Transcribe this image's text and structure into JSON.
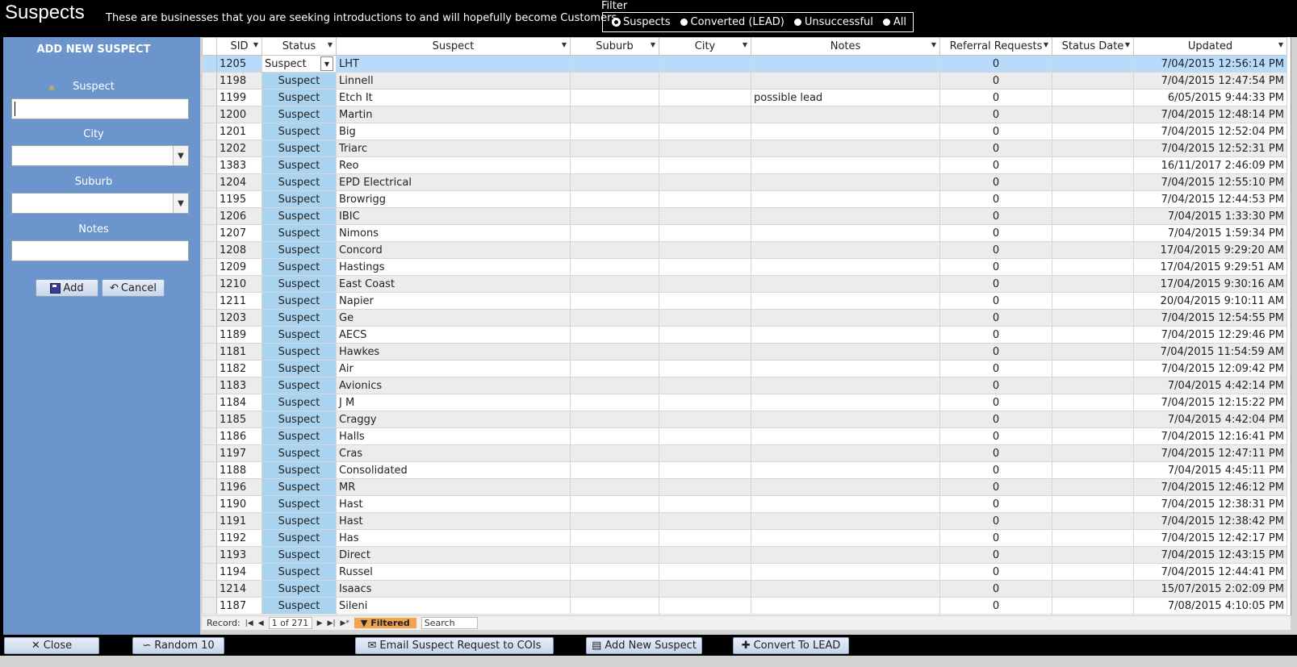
{
  "header": {
    "title": "Suspects",
    "description": "These are businesses that you are seeking introductions to and will hopefully become Customers.",
    "filter_label": "Filter",
    "filter_options": [
      {
        "label": "Suspects",
        "selected": true
      },
      {
        "label": "Converted (LEAD)",
        "selected": false
      },
      {
        "label": "Unsuccessful",
        "selected": false
      },
      {
        "label": "All",
        "selected": false
      }
    ]
  },
  "add_panel": {
    "heading": "ADD NEW SUSPECT",
    "required_marker": "*",
    "suspect_label": "Suspect",
    "suspect_value": "",
    "city_label": "City",
    "city_value": "",
    "suburb_label": "Suburb",
    "suburb_value": "",
    "notes_label": "Notes",
    "notes_value": "",
    "add_button": "Add",
    "cancel_button": "Cancel"
  },
  "grid": {
    "columns": [
      "SID",
      "Status",
      "Suspect",
      "Suburb",
      "City",
      "Notes",
      "Referral Requests",
      "Status Date",
      "Updated"
    ],
    "rows": [
      {
        "sid": "1205",
        "status": "Suspect",
        "suspect": "LHT",
        "suburb": "",
        "city": "",
        "notes": "",
        "referrals": "0",
        "status_date": "",
        "updated": "7/04/2015 12:56:14 PM"
      },
      {
        "sid": "1198",
        "status": "Suspect",
        "suspect": "Linnell",
        "suburb": "",
        "city": "",
        "notes": "",
        "referrals": "0",
        "status_date": "",
        "updated": "7/04/2015 12:47:54 PM"
      },
      {
        "sid": "1199",
        "status": "Suspect",
        "suspect": "Etch It",
        "suburb": "",
        "city": "",
        "notes": "possible lead",
        "referrals": "0",
        "status_date": "",
        "updated": "6/05/2015 9:44:33 PM"
      },
      {
        "sid": "1200",
        "status": "Suspect",
        "suspect": "Martin",
        "suburb": "",
        "city": "",
        "notes": "",
        "referrals": "0",
        "status_date": "",
        "updated": "7/04/2015 12:48:14 PM"
      },
      {
        "sid": "1201",
        "status": "Suspect",
        "suspect": "Big",
        "suburb": "",
        "city": "",
        "notes": "",
        "referrals": "0",
        "status_date": "",
        "updated": "7/04/2015 12:52:04 PM"
      },
      {
        "sid": "1202",
        "status": "Suspect",
        "suspect": "Triarc",
        "suburb": "",
        "city": "",
        "notes": "",
        "referrals": "0",
        "status_date": "",
        "updated": "7/04/2015 12:52:31 PM"
      },
      {
        "sid": "1383",
        "status": "Suspect",
        "suspect": "Reo",
        "suburb": "",
        "city": "",
        "notes": "",
        "referrals": "0",
        "status_date": "",
        "updated": "16/11/2017 2:46:09 PM"
      },
      {
        "sid": "1204",
        "status": "Suspect",
        "suspect": "EPD Electrical",
        "suburb": "",
        "city": "",
        "notes": "",
        "referrals": "0",
        "status_date": "",
        "updated": "7/04/2015 12:55:10 PM"
      },
      {
        "sid": "1195",
        "status": "Suspect",
        "suspect": "Browrigg",
        "suburb": "",
        "city": "",
        "notes": "",
        "referrals": "0",
        "status_date": "",
        "updated": "7/04/2015 12:44:53 PM"
      },
      {
        "sid": "1206",
        "status": "Suspect",
        "suspect": "IBIC",
        "suburb": "",
        "city": "",
        "notes": "",
        "referrals": "0",
        "status_date": "",
        "updated": "7/04/2015 1:33:30 PM"
      },
      {
        "sid": "1207",
        "status": "Suspect",
        "suspect": "Nimons",
        "suburb": "",
        "city": "",
        "notes": "",
        "referrals": "0",
        "status_date": "",
        "updated": "7/04/2015 1:59:34 PM"
      },
      {
        "sid": "1208",
        "status": "Suspect",
        "suspect": "Concord",
        "suburb": "",
        "city": "",
        "notes": "",
        "referrals": "0",
        "status_date": "",
        "updated": "17/04/2015 9:29:20 AM"
      },
      {
        "sid": "1209",
        "status": "Suspect",
        "suspect": "Hastings",
        "suburb": "",
        "city": "",
        "notes": "",
        "referrals": "0",
        "status_date": "",
        "updated": "17/04/2015 9:29:51 AM"
      },
      {
        "sid": "1210",
        "status": "Suspect",
        "suspect": "East Coast",
        "suburb": "",
        "city": "",
        "notes": "",
        "referrals": "0",
        "status_date": "",
        "updated": "17/04/2015 9:30:16 AM"
      },
      {
        "sid": "1211",
        "status": "Suspect",
        "suspect": "Napier",
        "suburb": "",
        "city": "",
        "notes": "",
        "referrals": "0",
        "status_date": "",
        "updated": "20/04/2015 9:10:11 AM"
      },
      {
        "sid": "1203",
        "status": "Suspect",
        "suspect": "Ge",
        "suburb": "",
        "city": "",
        "notes": "",
        "referrals": "0",
        "status_date": "",
        "updated": "7/04/2015 12:54:55 PM"
      },
      {
        "sid": "1189",
        "status": "Suspect",
        "suspect": "AECS",
        "suburb": "",
        "city": "",
        "notes": "",
        "referrals": "0",
        "status_date": "",
        "updated": "7/04/2015 12:29:46 PM"
      },
      {
        "sid": "1181",
        "status": "Suspect",
        "suspect": "Hawkes",
        "suburb": "",
        "city": "",
        "notes": "",
        "referrals": "0",
        "status_date": "",
        "updated": "7/04/2015 11:54:59 AM"
      },
      {
        "sid": "1182",
        "status": "Suspect",
        "suspect": "Air",
        "suburb": "",
        "city": "",
        "notes": "",
        "referrals": "0",
        "status_date": "",
        "updated": "7/04/2015 12:09:42 PM"
      },
      {
        "sid": "1183",
        "status": "Suspect",
        "suspect": "Avionics",
        "suburb": "",
        "city": "",
        "notes": "",
        "referrals": "0",
        "status_date": "",
        "updated": "7/04/2015 4:42:14 PM"
      },
      {
        "sid": "1184",
        "status": "Suspect",
        "suspect": "J M",
        "suburb": "",
        "city": "",
        "notes": "",
        "referrals": "0",
        "status_date": "",
        "updated": "7/04/2015 12:15:22 PM"
      },
      {
        "sid": "1185",
        "status": "Suspect",
        "suspect": "Craggy",
        "suburb": "",
        "city": "",
        "notes": "",
        "referrals": "0",
        "status_date": "",
        "updated": "7/04/2015 4:42:04 PM"
      },
      {
        "sid": "1186",
        "status": "Suspect",
        "suspect": "Halls",
        "suburb": "",
        "city": "",
        "notes": "",
        "referrals": "0",
        "status_date": "",
        "updated": "7/04/2015 12:16:41 PM"
      },
      {
        "sid": "1197",
        "status": "Suspect",
        "suspect": "Cras",
        "suburb": "",
        "city": "",
        "notes": "",
        "referrals": "0",
        "status_date": "",
        "updated": "7/04/2015 12:47:11 PM"
      },
      {
        "sid": "1188",
        "status": "Suspect",
        "suspect": "Consolidated",
        "suburb": "",
        "city": "",
        "notes": "",
        "referrals": "0",
        "status_date": "",
        "updated": "7/04/2015 4:45:11 PM"
      },
      {
        "sid": "1196",
        "status": "Suspect",
        "suspect": "MR",
        "suburb": "",
        "city": "",
        "notes": "",
        "referrals": "0",
        "status_date": "",
        "updated": "7/04/2015 12:46:12 PM"
      },
      {
        "sid": "1190",
        "status": "Suspect",
        "suspect": "Hast",
        "suburb": "",
        "city": "",
        "notes": "",
        "referrals": "0",
        "status_date": "",
        "updated": "7/04/2015 12:38:31 PM"
      },
      {
        "sid": "1191",
        "status": "Suspect",
        "suspect": "Hast",
        "suburb": "",
        "city": "",
        "notes": "",
        "referrals": "0",
        "status_date": "",
        "updated": "7/04/2015 12:38:42 PM"
      },
      {
        "sid": "1192",
        "status": "Suspect",
        "suspect": "Has",
        "suburb": "",
        "city": "",
        "notes": "",
        "referrals": "0",
        "status_date": "",
        "updated": "7/04/2015 12:42:17 PM"
      },
      {
        "sid": "1193",
        "status": "Suspect",
        "suspect": "Direct",
        "suburb": "",
        "city": "",
        "notes": "",
        "referrals": "0",
        "status_date": "",
        "updated": "7/04/2015 12:43:15 PM"
      },
      {
        "sid": "1194",
        "status": "Suspect",
        "suspect": "Russel",
        "suburb": "",
        "city": "",
        "notes": "",
        "referrals": "0",
        "status_date": "",
        "updated": "7/04/2015 12:44:41 PM"
      },
      {
        "sid": "1214",
        "status": "Suspect",
        "suspect": "Isaacs",
        "suburb": "",
        "city": "",
        "notes": "",
        "referrals": "0",
        "status_date": "",
        "updated": "15/07/2015 2:02:09 PM"
      },
      {
        "sid": "1187",
        "status": "Suspect",
        "suspect": "Sileni",
        "suburb": "",
        "city": "",
        "notes": "",
        "referrals": "0",
        "status_date": "",
        "updated": "7/08/2015 4:10:05 PM"
      }
    ]
  },
  "navigation": {
    "record_label": "Record:",
    "record_position": "1 of 271",
    "filtered_label": "Filtered",
    "search_placeholder": "Search"
  },
  "footer": {
    "close": "Close",
    "random": "Random 10",
    "email": "Email Suspect Request to COIs",
    "add_new": "Add New Suspect",
    "convert": "Convert To LEAD"
  },
  "colors": {
    "panel_blue": "#6b95cc",
    "status_cell_blue": "#a9d3ef",
    "current_row": "#b8dafb",
    "filtered_orange": "#f3a24d"
  }
}
